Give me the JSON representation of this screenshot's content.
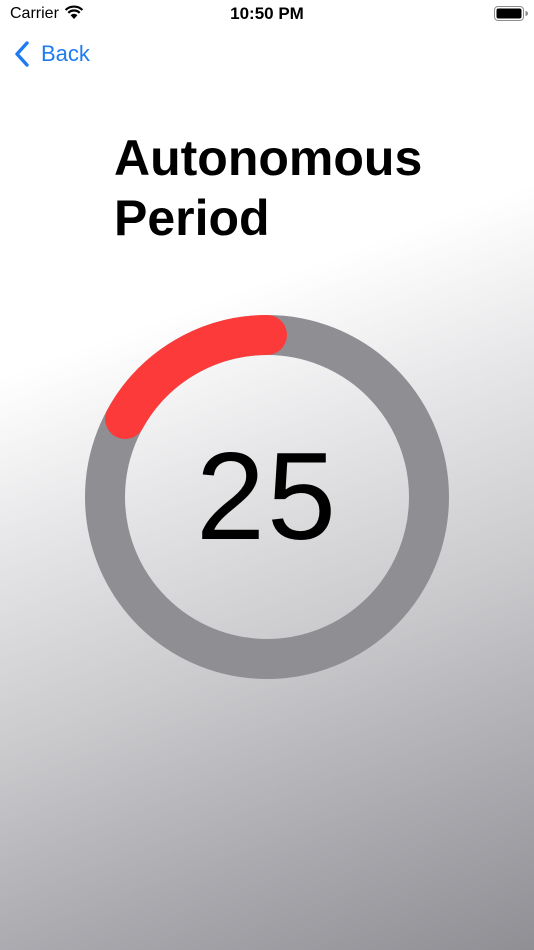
{
  "status_bar": {
    "carrier": "Carrier",
    "time": "10:50 PM"
  },
  "nav": {
    "back_label": "Back"
  },
  "title": "Autonomous Period",
  "timer": {
    "value": "25",
    "elapsed_fraction": 0.17,
    "elapsed_color": "#fd3a3a",
    "remaining_color": "#8e8e93"
  },
  "icons": {
    "wifi": "wifi-icon",
    "battery": "battery-icon",
    "back": "chevron-left-icon"
  }
}
